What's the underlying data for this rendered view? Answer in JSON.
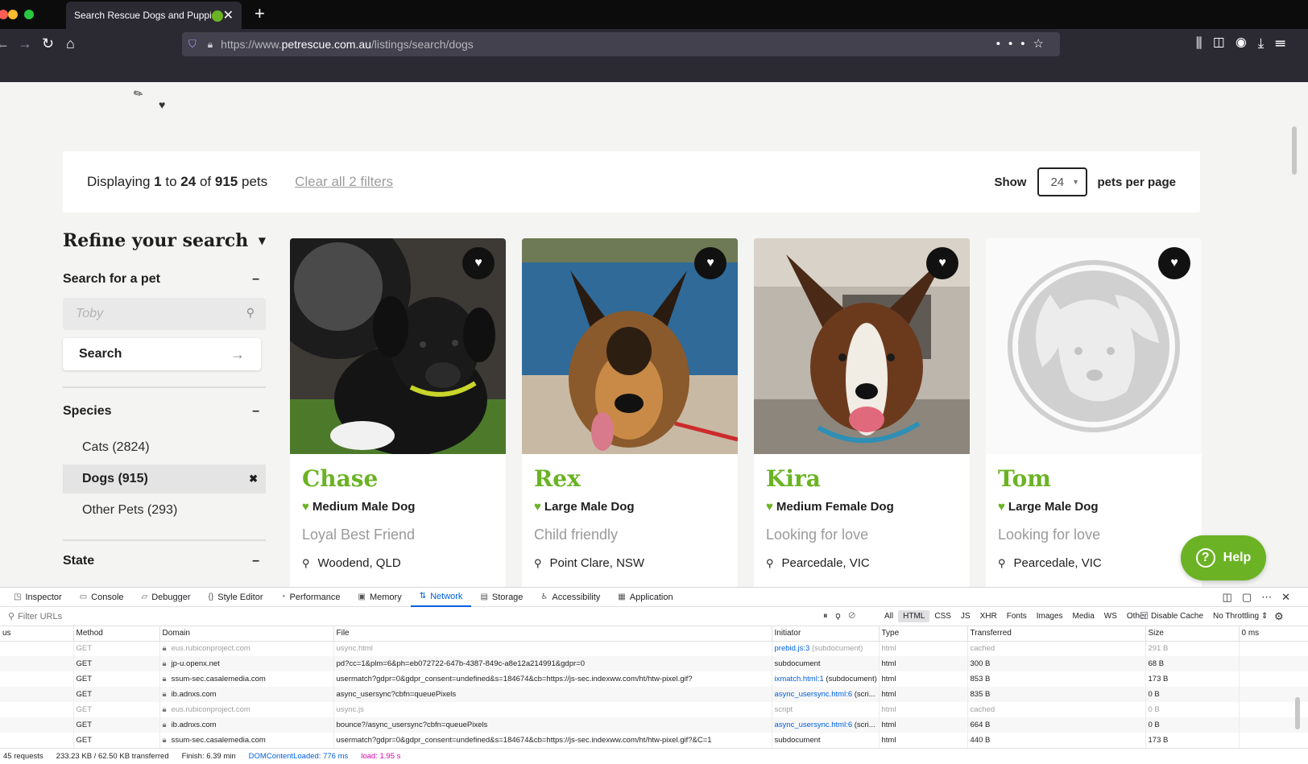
{
  "browser": {
    "tab_title": "Search Rescue Dogs and Puppies",
    "url_prefix": "https://www.",
    "url_domain": "petrescue.com.au",
    "url_path": "/listings/search/dogs"
  },
  "results": {
    "displaying": "Displaying",
    "from": "1",
    "to_word": "to",
    "to": "24",
    "of_word": "of",
    "total": "915",
    "unit": "pets",
    "clear_filters": "Clear all 2 filters",
    "show_label": "Show",
    "per_page": "24",
    "per_page_suffix": "pets per page"
  },
  "sidebar": {
    "title": "Refine your search",
    "search_section": "Search for a pet",
    "search_placeholder": "Toby",
    "search_button": "Search",
    "species_section": "Species",
    "species": [
      {
        "label": "Cats (2824)"
      },
      {
        "label": "Dogs (915)"
      },
      {
        "label": "Other Pets (293)"
      }
    ],
    "state_section": "State"
  },
  "cards": [
    {
      "name": "Chase",
      "desc": "Medium Male Dog",
      "tagline": "Loyal Best Friend",
      "location": "Woodend, QLD"
    },
    {
      "name": "Rex",
      "desc": "Large Male Dog",
      "tagline": "Child friendly",
      "location": "Point Clare, NSW"
    },
    {
      "name": "Kira",
      "desc": "Medium Female Dog",
      "tagline": "Looking for love",
      "location": "Pearcedale, VIC"
    },
    {
      "name": "Tom",
      "desc": "Large Male Dog",
      "tagline": "Looking for love",
      "location": "Pearcedale, VIC"
    }
  ],
  "help_label": "Help",
  "devtools": {
    "tabs": [
      "Inspector",
      "Console",
      "Debugger",
      "Style Editor",
      "Performance",
      "Memory",
      "Network",
      "Storage",
      "Accessibility",
      "Application"
    ],
    "filter_placeholder": "Filter URLs",
    "types": [
      "All",
      "HTML",
      "CSS",
      "JS",
      "XHR",
      "Fonts",
      "Images",
      "Media",
      "WS",
      "Other"
    ],
    "disable_cache": "Disable Cache",
    "throttling": "No Throttling",
    "columns": [
      "us",
      "Method",
      "Domain",
      "File",
      "Initiator",
      "Type",
      "Transferred",
      "Size",
      "0 ms"
    ],
    "rows": [
      {
        "method": "GET",
        "domain": "eus.rubiconproject.com",
        "file": "usync.html",
        "initiator": "prebid.js:3",
        "initiator_extra": "(subdocument)",
        "type": "html",
        "transferred": "cached",
        "size": "291 B",
        "dim": true
      },
      {
        "method": "GET",
        "domain": "jp-u.openx.net",
        "file": "pd?cc=1&plm=6&ph=eb072722-647b-4387-849c-a8e12a214991&gdpr=0",
        "initiator": "",
        "initiator_extra": "subdocument",
        "type": "html",
        "transferred": "300 B",
        "size": "68 B",
        "dim": false
      },
      {
        "method": "GET",
        "domain": "ssum-sec.casalemedia.com",
        "file": "usermatch?gdpr=0&gdpr_consent=undefined&s=184674&cb=https://js-sec.indexww.com/ht/htw-pixel.gif?",
        "initiator": "ixmatch.html:1",
        "initiator_extra": "(subdocument)",
        "type": "html",
        "transferred": "853 B",
        "size": "173 B",
        "dim": false
      },
      {
        "method": "GET",
        "domain": "ib.adnxs.com",
        "file": "async_usersync?cbfn=queuePixels",
        "initiator": "async_usersync.html:6",
        "initiator_extra": "(scri...",
        "type": "html",
        "transferred": "835 B",
        "size": "0 B",
        "dim": false
      },
      {
        "method": "GET",
        "domain": "eus.rubiconproject.com",
        "file": "usync.js",
        "initiator": "",
        "initiator_extra": "script",
        "type": "html",
        "transferred": "cached",
        "size": "0 B",
        "dim": true
      },
      {
        "method": "GET",
        "domain": "ib.adnxs.com",
        "file": "bounce?/async_usersync?cbfn=queuePixels",
        "initiator": "async_usersync.html:6",
        "initiator_extra": "(scri...",
        "type": "html",
        "transferred": "664 B",
        "size": "0 B",
        "dim": false
      },
      {
        "method": "GET",
        "domain": "ssum-sec.casalemedia.com",
        "file": "usermatch?gdpr=0&gdpr_consent=undefined&s=184674&cb=https://js-sec.indexww.com/ht/htw-pixel.gif?&C=1",
        "initiator": "",
        "initiator_extra": "subdocument",
        "type": "html",
        "transferred": "440 B",
        "size": "173 B",
        "dim": false
      }
    ],
    "status": {
      "requests": "45 requests",
      "transferred": "233.23 KB / 62.50 KB transferred",
      "finish": "Finish: 6.39 min",
      "dcl": "DOMContentLoaded: 776 ms",
      "load": "load: 1.95 s"
    }
  },
  "colors": {
    "brand_green": "#6bb324",
    "chrome_dark": "#2b2a33",
    "devtools_blue": "#0060df"
  }
}
